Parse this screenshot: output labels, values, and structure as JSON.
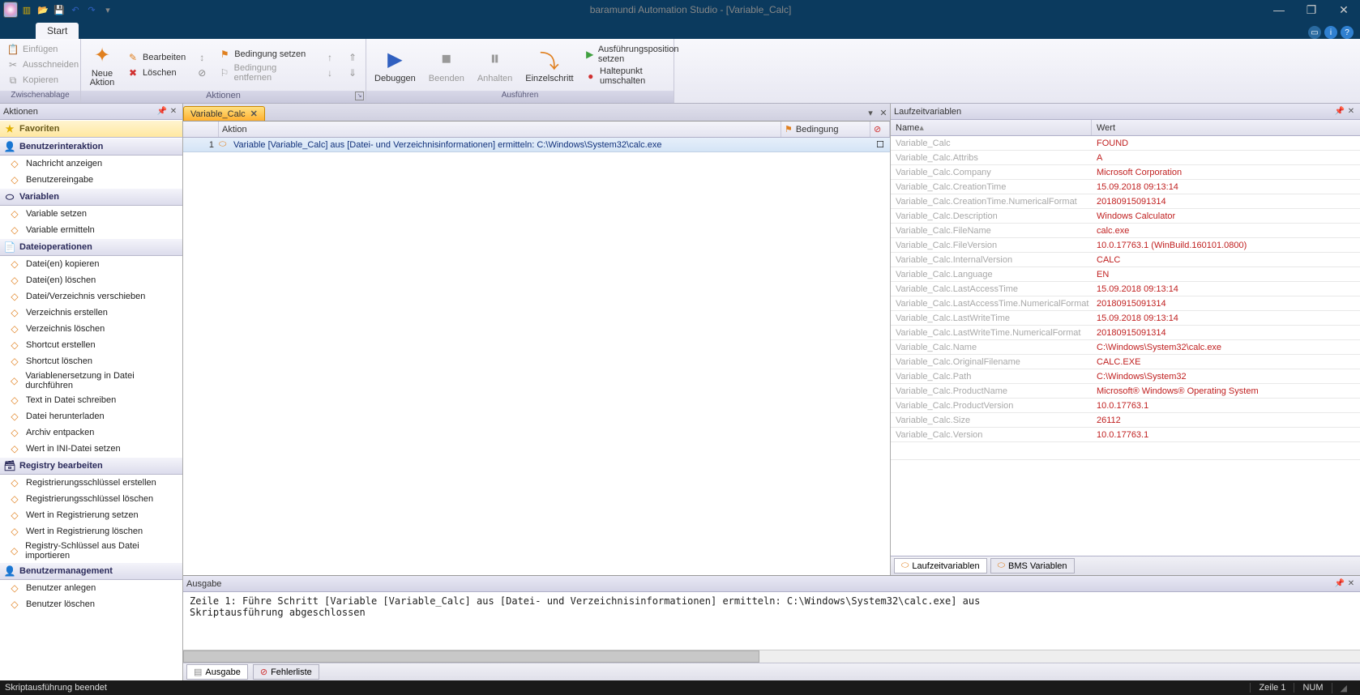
{
  "window": {
    "title": "baramundi Automation Studio - [Variable_Calc]"
  },
  "tabs": {
    "start": "Start"
  },
  "ribbon": {
    "clipboard": {
      "label": "Zwischenablage",
      "paste": "Einfügen",
      "cut": "Ausschneiden",
      "copy": "Kopieren"
    },
    "actions": {
      "label": "Aktionen",
      "new_action": "Neue\nAktion",
      "edit": "Bearbeiten",
      "delete": "Löschen",
      "cond_set": "Bedingung setzen",
      "cond_remove": "Bedingung entfernen"
    },
    "execute": {
      "label": "Ausführen",
      "debug": "Debuggen",
      "stop": "Beenden",
      "pause": "Anhalten",
      "step": "Einzelschritt",
      "set_exec_pos": "Ausführungsposition setzen",
      "toggle_bp": "Haltepunkt umschalten"
    }
  },
  "sidebar": {
    "title": "Aktionen",
    "favorites": "Favoriten",
    "sections": [
      {
        "label": "Benutzerinteraktion",
        "items": [
          "Nachricht anzeigen",
          "Benutzereingabe"
        ]
      },
      {
        "label": "Variablen",
        "items": [
          "Variable setzen",
          "Variable ermitteln"
        ]
      },
      {
        "label": "Dateioperationen",
        "items": [
          "Datei(en) kopieren",
          "Datei(en) löschen",
          "Datei/Verzeichnis verschieben",
          "Verzeichnis erstellen",
          "Verzeichnis löschen",
          "Shortcut erstellen",
          "Shortcut löschen",
          "Variablenersetzung in Datei durchführen",
          "Text in Datei schreiben",
          "Datei herunterladen",
          "Archiv entpacken",
          "Wert in INI-Datei setzen"
        ]
      },
      {
        "label": "Registry bearbeiten",
        "items": [
          "Registrierungsschlüssel erstellen",
          "Registrierungsschlüssel löschen",
          "Wert in Registrierung setzen",
          "Wert in Registrierung löschen",
          "Registry-Schlüssel aus Datei importieren"
        ]
      },
      {
        "label": "Benutzermanagement",
        "items": [
          "Benutzer anlegen",
          "Benutzer löschen"
        ]
      }
    ]
  },
  "document": {
    "tab_name": "Variable_Calc",
    "grid": {
      "col_action": "Aktion",
      "col_condition": "Bedingung"
    },
    "rows": [
      {
        "num": "1",
        "text": "Variable [Variable_Calc] aus [Datei- und Verzeichnisinformationen] ermitteln: C:\\Windows\\System32\\calc.exe"
      }
    ]
  },
  "runtime_vars": {
    "title": "Laufzeitvariablen",
    "col_name": "Name",
    "col_value": "Wert",
    "tab_runtime": "Laufzeitvariablen",
    "tab_bms": "BMS Variablen",
    "rows": [
      {
        "name": "Variable_Calc",
        "value": "FOUND"
      },
      {
        "name": "Variable_Calc.Attribs",
        "value": "A"
      },
      {
        "name": "Variable_Calc.Company",
        "value": "Microsoft Corporation"
      },
      {
        "name": "Variable_Calc.CreationTime",
        "value": "15.09.2018  09:13:14"
      },
      {
        "name": "Variable_Calc.CreationTime.NumericalFormat",
        "value": "20180915091314"
      },
      {
        "name": "Variable_Calc.Description",
        "value": "Windows Calculator"
      },
      {
        "name": "Variable_Calc.FileName",
        "value": "calc.exe"
      },
      {
        "name": "Variable_Calc.FileVersion",
        "value": "10.0.17763.1 (WinBuild.160101.0800)"
      },
      {
        "name": "Variable_Calc.InternalVersion",
        "value": "CALC"
      },
      {
        "name": "Variable_Calc.Language",
        "value": "EN"
      },
      {
        "name": "Variable_Calc.LastAccessTime",
        "value": "15.09.2018  09:13:14"
      },
      {
        "name": "Variable_Calc.LastAccessTime.NumericalFormat",
        "value": "20180915091314"
      },
      {
        "name": "Variable_Calc.LastWriteTime",
        "value": "15.09.2018  09:13:14"
      },
      {
        "name": "Variable_Calc.LastWriteTime.NumericalFormat",
        "value": "20180915091314"
      },
      {
        "name": "Variable_Calc.Name",
        "value": "C:\\Windows\\System32\\calc.exe"
      },
      {
        "name": "Variable_Calc.OriginalFilename",
        "value": "CALC.EXE"
      },
      {
        "name": "Variable_Calc.Path",
        "value": "C:\\Windows\\System32"
      },
      {
        "name": "Variable_Calc.ProductName",
        "value": "Microsoft® Windows® Operating System"
      },
      {
        "name": "Variable_Calc.ProductVersion",
        "value": "10.0.17763.1"
      },
      {
        "name": "Variable_Calc.Size",
        "value": "26112"
      },
      {
        "name": "Variable_Calc.Version",
        "value": "10.0.17763.1"
      }
    ]
  },
  "output": {
    "title": "Ausgabe",
    "text": "Zeile 1: Führe Schritt [Variable [Variable_Calc] aus [Datei- und Verzeichnisinformationen] ermitteln: C:\\Windows\\System32\\calc.exe] aus\nSkriptausführung abgeschlossen",
    "tab_output": "Ausgabe",
    "tab_errors": "Fehlerliste"
  },
  "statusbar": {
    "left": "Skriptausführung beendet",
    "line": "Zeile  1",
    "num": "NUM"
  }
}
